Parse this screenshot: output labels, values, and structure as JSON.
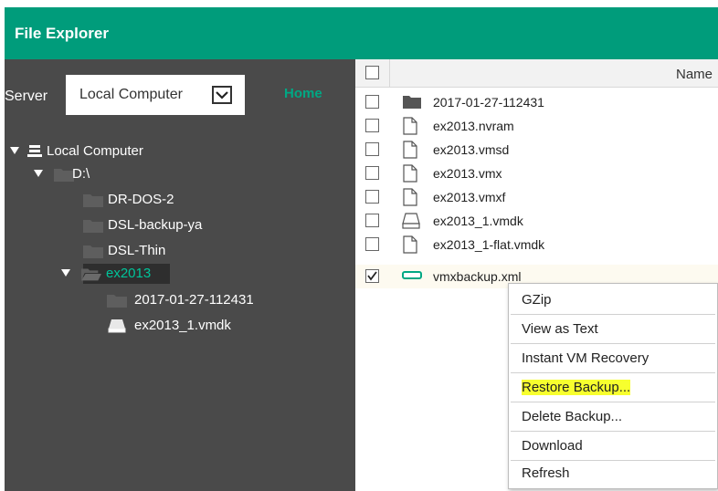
{
  "window": {
    "title": "File Explorer"
  },
  "left": {
    "server_label": "Server",
    "server_value": "Local Computer",
    "home_link": "Home",
    "tree": {
      "root": "Local Computer",
      "drive": "D:\\",
      "folders": [
        "DR-DOS-2",
        "DSL-backup-ya",
        "DSL-Thin"
      ],
      "selected": "ex2013",
      "children": [
        "2017-01-27-112431",
        "ex2013_1.vmdk"
      ]
    }
  },
  "right": {
    "column_name": "Name",
    "files": [
      {
        "name": "2017-01-27-112431",
        "icon": "folder-icon",
        "checked": false
      },
      {
        "name": "ex2013.nvram",
        "icon": "file-icon",
        "checked": false
      },
      {
        "name": "ex2013.vmsd",
        "icon": "file-icon",
        "checked": false
      },
      {
        "name": "ex2013.vmx",
        "icon": "file-icon",
        "checked": false
      },
      {
        "name": "ex2013.vmxf",
        "icon": "file-icon",
        "checked": false
      },
      {
        "name": "ex2013_1.vmdk",
        "icon": "disk-icon",
        "checked": false
      },
      {
        "name": "ex2013_1-flat.vmdk",
        "icon": "file-icon",
        "checked": false
      },
      {
        "name": "vmxbackup.xml",
        "icon": "backup-icon",
        "checked": true
      }
    ]
  },
  "context_menu": {
    "items": [
      "GZip",
      "View as Text",
      "Instant VM Recovery",
      "Restore Backup...",
      "Delete Backup...",
      "Download",
      "Refresh"
    ],
    "highlighted": "Restore Backup..."
  },
  "colors": {
    "accent": "#009c7b",
    "left_panel": "#4a4a4a",
    "highlight": "#f7ff2e"
  }
}
